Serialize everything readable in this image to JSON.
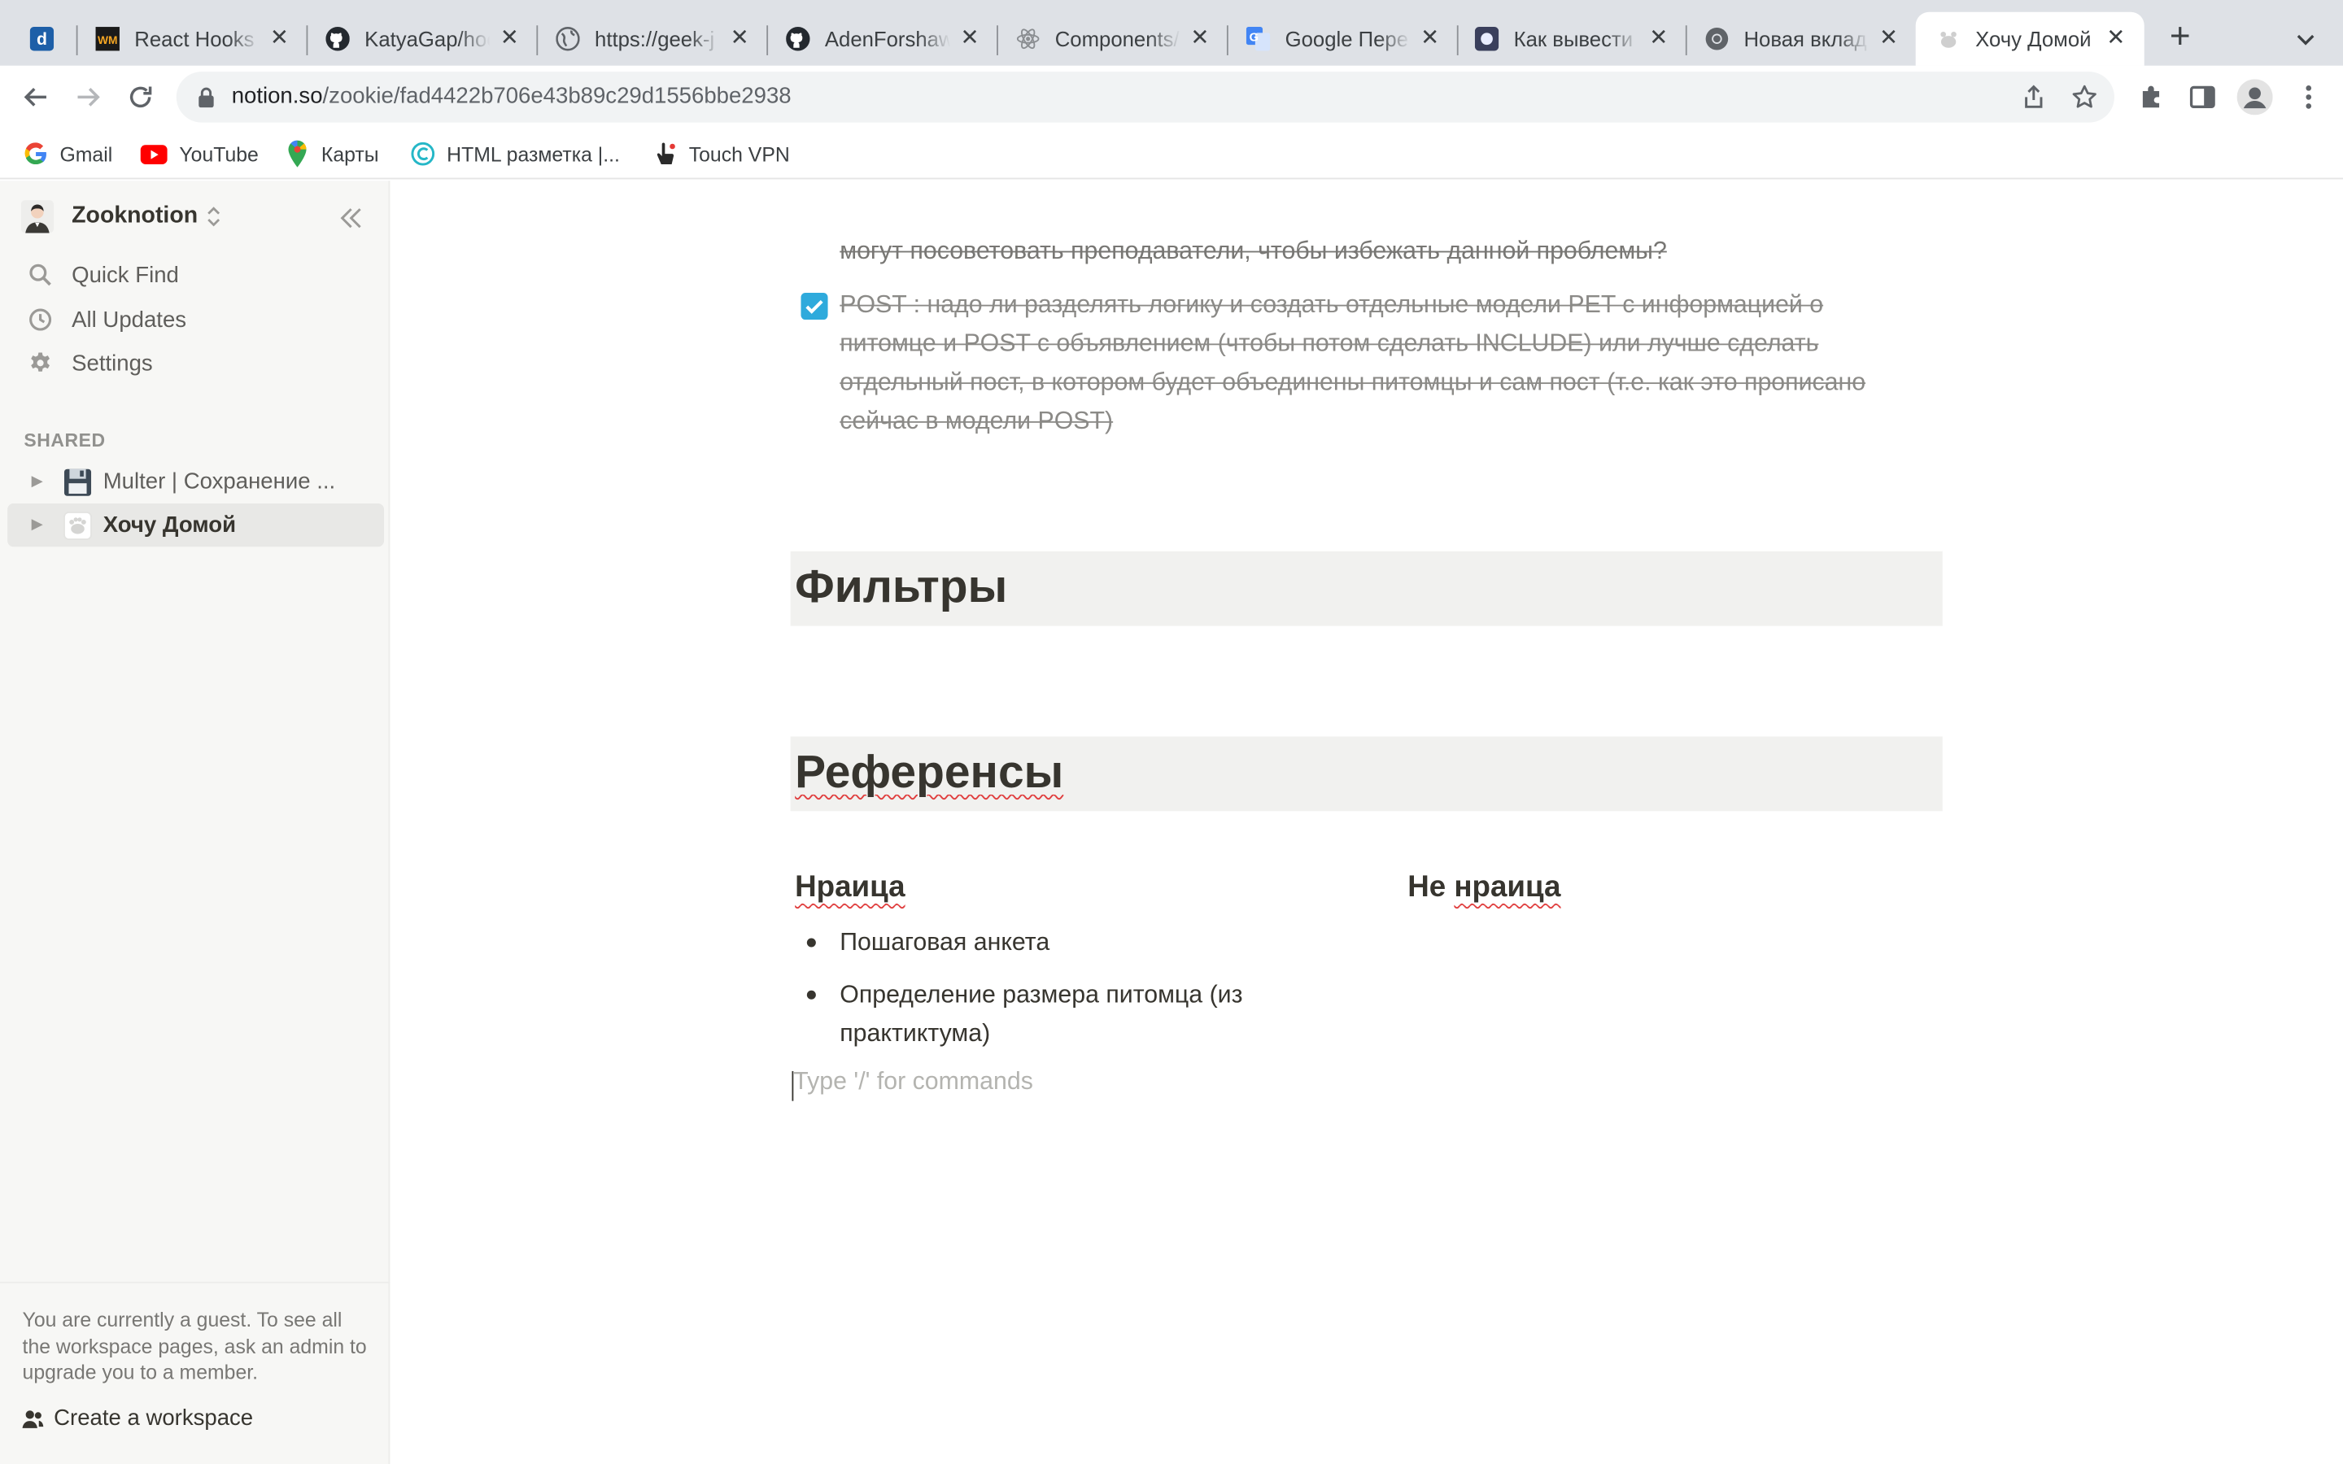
{
  "browser": {
    "tabs": [
      {
        "title": "",
        "icon": "d-icon"
      },
      {
        "title": "React Hooks - ",
        "icon": "wm-icon"
      },
      {
        "title": "KatyaGap/hoo",
        "icon": "github-icon"
      },
      {
        "title": "https://geek-j",
        "icon": "globe-icon"
      },
      {
        "title": "AdenForshaw",
        "icon": "github-icon"
      },
      {
        "title": "Components/",
        "icon": "react-icon"
      },
      {
        "title": "Google Пере",
        "icon": "google-translate-icon"
      },
      {
        "title": "Как вывести",
        "icon": "app-icon"
      },
      {
        "title": "Новая вклад",
        "icon": "chrome-icon"
      },
      {
        "title": "Хочу Домой",
        "icon": "notion-page-icon"
      }
    ],
    "close_glyph": "✕",
    "new_tab_glyph": "+",
    "url_host": "notion.so",
    "url_path": "/zookie/fad4422b706e43b89c29d1556bbe2938",
    "bookmarks": [
      {
        "label": "Gmail",
        "icon": "google-icon"
      },
      {
        "label": "YouTube",
        "icon": "youtube-icon"
      },
      {
        "label": "Карты",
        "icon": "maps-icon"
      },
      {
        "label": "HTML разметка |...",
        "icon": "html-icon"
      },
      {
        "label": "Touch VPN",
        "icon": "vpn-icon"
      }
    ],
    "colors": {
      "tabbar": "#dee1e6",
      "omnibox": "#f1f3f4"
    }
  },
  "sidebar": {
    "workspace_name": "Zooknotion",
    "workspace_chevron": "⌃",
    "nav": [
      {
        "label": "Quick Find",
        "icon": "search-icon"
      },
      {
        "label": "All Updates",
        "icon": "clock-icon"
      },
      {
        "label": "Settings",
        "icon": "gear-icon"
      }
    ],
    "shared_label": "SHARED",
    "pages": [
      {
        "label": "Multer | Сохранение ...",
        "icon": "floppy-disk-icon",
        "selected": false
      },
      {
        "label": "Хочу Домой",
        "icon": "page-icon",
        "selected": true
      }
    ],
    "expand_glyph": "▶",
    "guest_notice": "You are currently a guest. To see all the workspace pages, ask an admin to upgrade you to a member.",
    "create_workspace": "Create a workspace"
  },
  "page": {
    "cut_line": "могут посоветовать преподаватели, чтобы избежать данной проблемы?",
    "todo_text": "POST : надо ли разделять логику и создать отдельные модели PET с информацией о питомце и POST с объявлением (чтобы потом сделать INCLUDE) или лучше сделать отдельный пост, в котором будет объединены питомцы и сам пост (т.е. как это прописано сейчас в модели POST)",
    "todo_checked": true,
    "heading_filters": "Фильтры",
    "heading_refs": "Референсы",
    "col_left_title": "Нраица",
    "col_right_prefix": "Не ",
    "col_right_word": "нраица",
    "bullets": [
      "Пошаговая анкета",
      "Определение размера питомца (из практиктума)"
    ],
    "placeholder": "Type '/' for commands",
    "colors": {
      "heading_bg": "#f1f1ef",
      "checkbox": "#2eaadc",
      "sidebar_bg": "#f7f7f5"
    }
  }
}
